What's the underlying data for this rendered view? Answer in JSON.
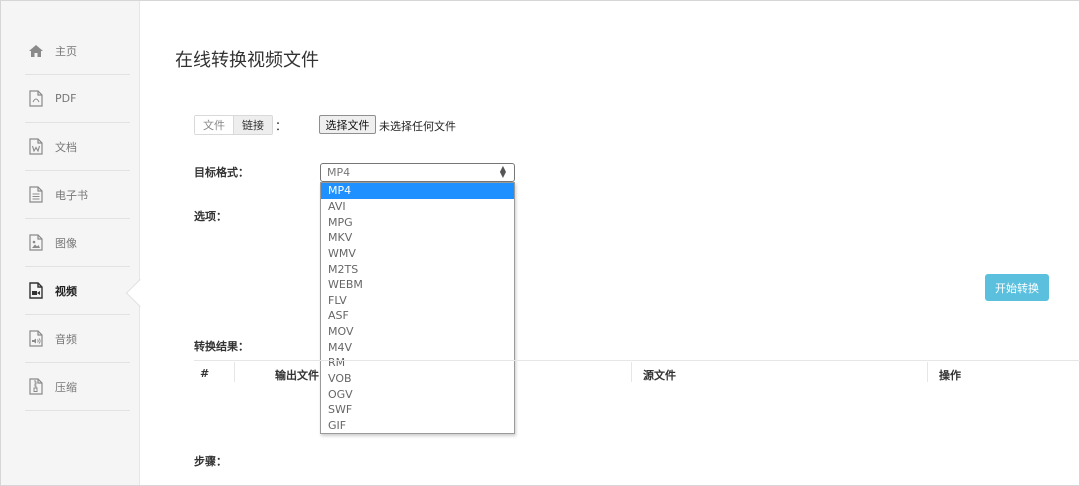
{
  "sidebar": {
    "items": [
      {
        "label": "主页",
        "icon": "home-icon"
      },
      {
        "label": "PDF",
        "icon": "pdf-file-icon"
      },
      {
        "label": "文档",
        "icon": "word-document-icon"
      },
      {
        "label": "电子书",
        "icon": "ebook-icon"
      },
      {
        "label": "图像",
        "icon": "image-file-icon"
      },
      {
        "label": "视频",
        "icon": "video-file-icon",
        "active": true
      },
      {
        "label": "音频",
        "icon": "audio-file-icon"
      },
      {
        "label": "压缩",
        "icon": "archive-file-icon"
      }
    ]
  },
  "main": {
    "title": "在线转换视频文件",
    "source_tabs": {
      "file": "文件",
      "link": "链接",
      "colon": "："
    },
    "file_input": {
      "button_label": "选择文件",
      "status": "未选择任何文件"
    },
    "target_format": {
      "label": "目标格式：",
      "selected": "MP4",
      "options": [
        "MP4",
        "AVI",
        "MPG",
        "MKV",
        "WMV",
        "M2TS",
        "WEBM",
        "FLV",
        "ASF",
        "MOV",
        "M4V",
        "RM",
        "VOB",
        "OGV",
        "SWF",
        "GIF"
      ]
    },
    "options_label": "选项：",
    "start_button": "开始转换",
    "results": {
      "label": "转换结果：",
      "columns": [
        "#",
        "输出文件",
        "源文件",
        "操作"
      ]
    },
    "steps_label": "步骤："
  },
  "colors": {
    "accent": "#5bc0de",
    "highlight": "#1e90ff",
    "sidebar_bg": "#f5f5f5"
  }
}
